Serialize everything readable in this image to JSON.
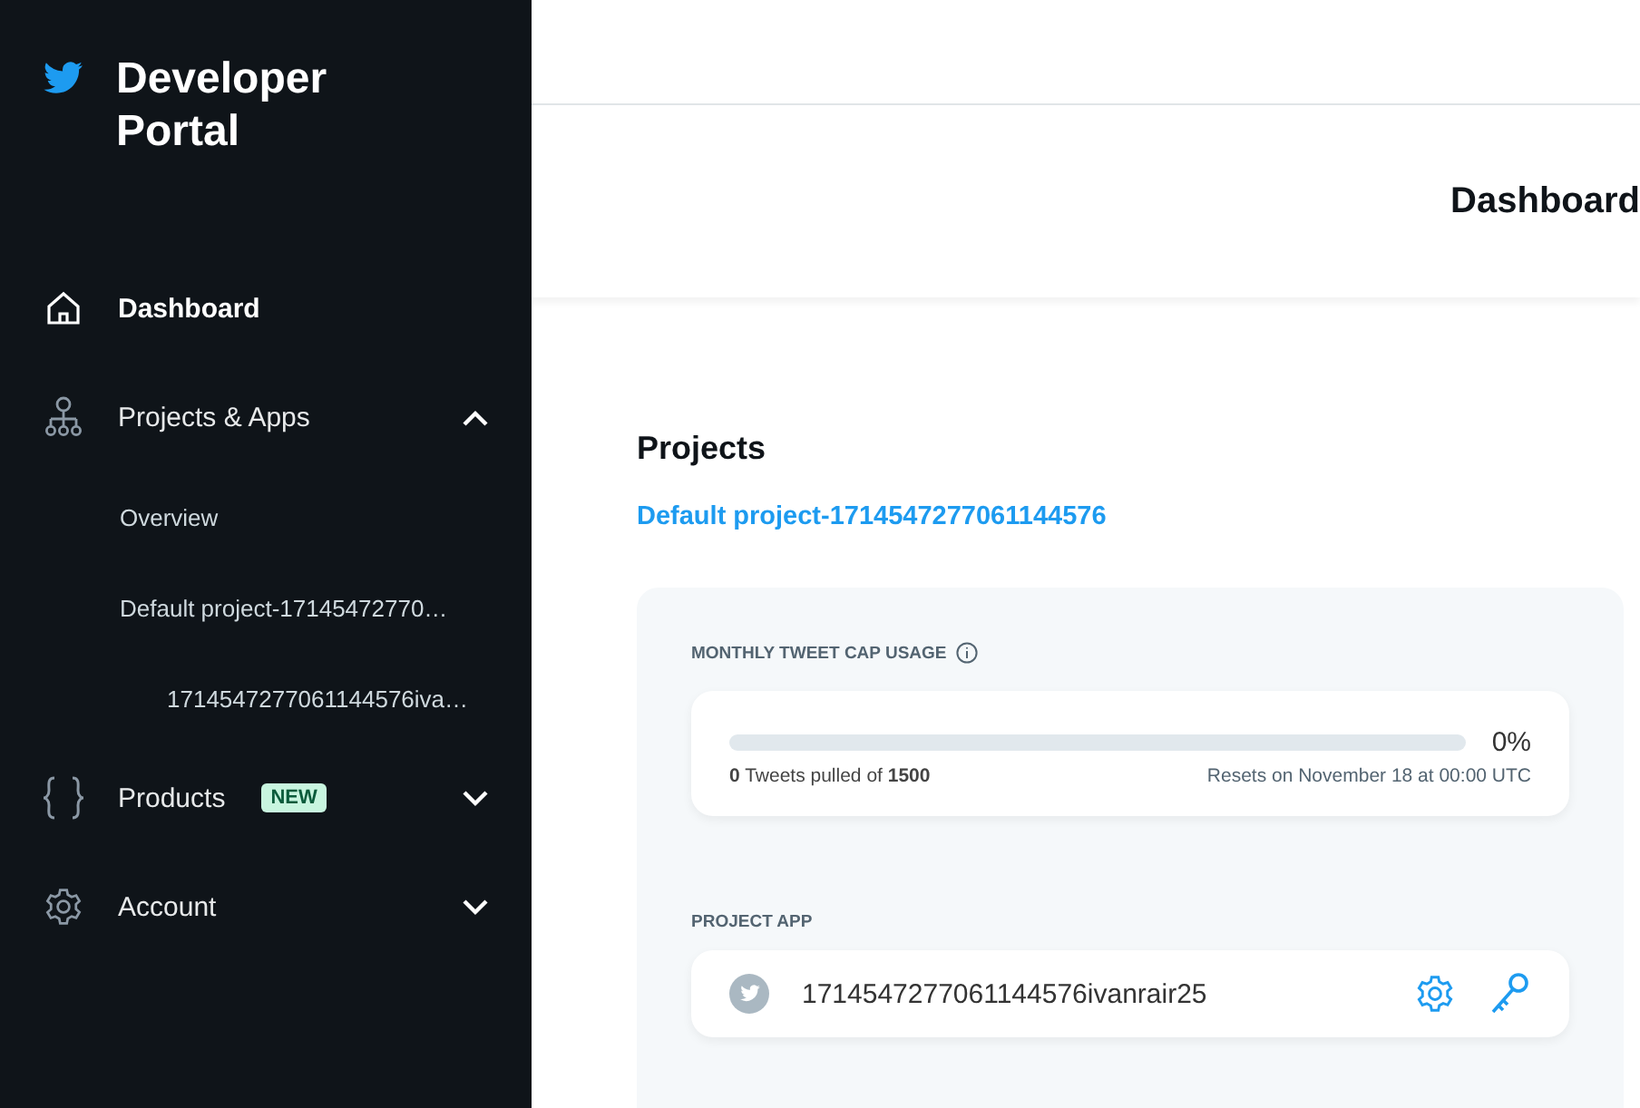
{
  "brand": {
    "title": "Developer Portal"
  },
  "nav": [
    {
      "label": "Dashboard",
      "selected": true
    },
    {
      "label": "Projects & Apps",
      "selected": false,
      "expanded": true,
      "children": [
        {
          "label": "Overview",
          "selected": false
        },
        {
          "label": "Default project-17145472770…",
          "selected": false,
          "children": [
            {
              "label": "1714547277061144576iva…",
              "selected": false
            }
          ]
        }
      ]
    },
    {
      "label": "Products",
      "badge": "NEW",
      "selected": false,
      "expanded": false
    },
    {
      "label": "Account",
      "selected": false,
      "expanded": false
    }
  ],
  "page_title": "Dashboard",
  "projects": {
    "heading": "Projects",
    "project_link": "Default project-1714547277061144576",
    "usage": {
      "label": "MONTHLY TWEET CAP USAGE",
      "level": 0,
      "percent": "0%",
      "pulled": "**0** Tweets pulled of **1500**",
      "resets": "Resets on November 18 at 00:00 UTC"
    },
    "project_app": {
      "label": "PROJECT APP",
      "app_name": "1714547277061144576ivanrair25"
    }
  }
}
